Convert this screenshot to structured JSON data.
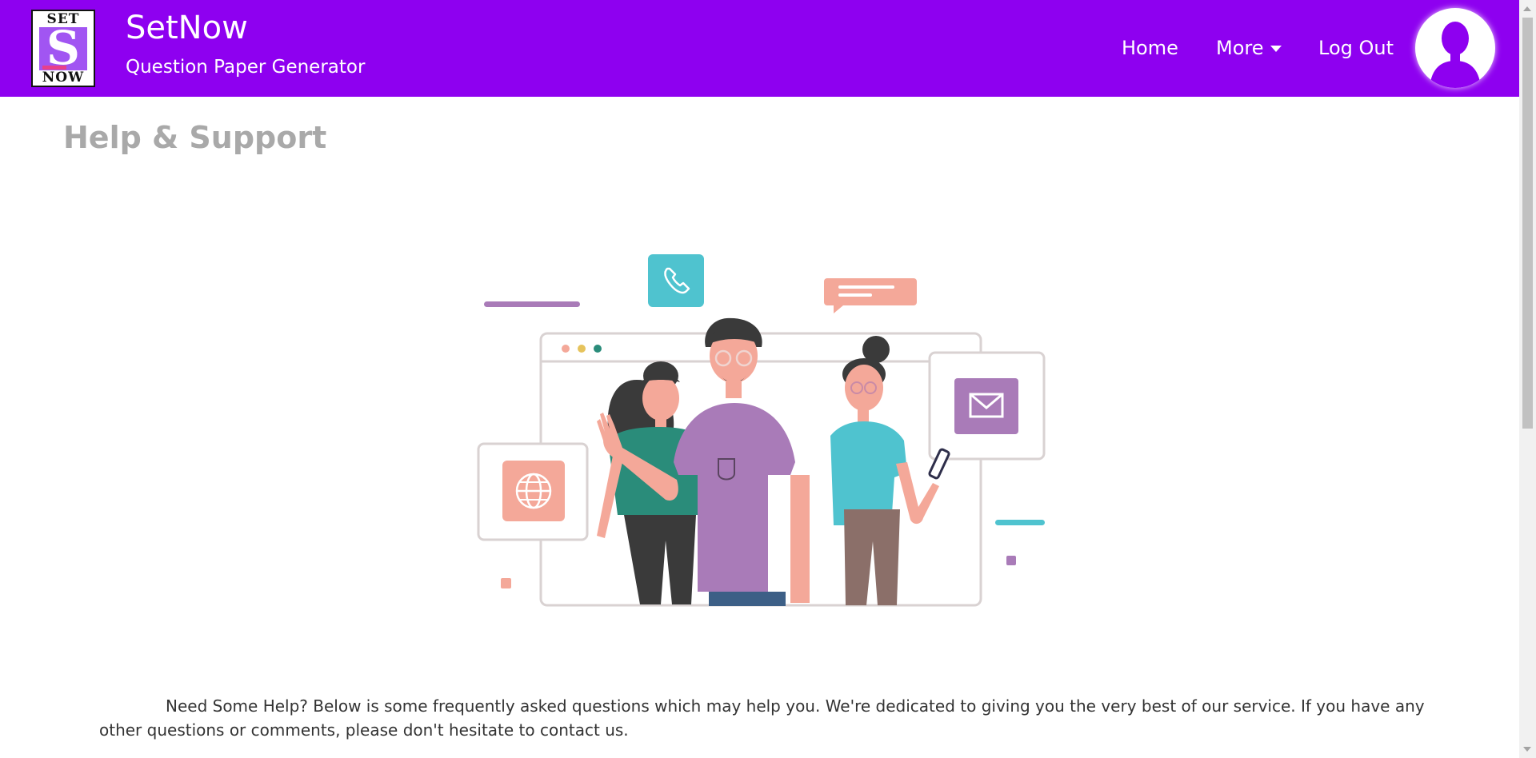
{
  "brand": {
    "logo_top": "SET",
    "logo_letter": "S",
    "logo_bottom": "NOW",
    "title": "SetNow",
    "subtitle": "Question Paper Generator"
  },
  "nav": {
    "home": "Home",
    "more": "More",
    "logout": "Log Out"
  },
  "page": {
    "title": "Help & Support",
    "intro": "Need Some Help? Below is some frequently asked questions which may help you. We're dedicated to giving you the very best of our service. If you have any other questions or comments, please don't hesitate to contact us."
  },
  "colors": {
    "navbar": "#8e00f0",
    "title_gray": "#a9a9a9",
    "illustration_purple": "#a97bb8",
    "illustration_teal": "#4fc3cf",
    "illustration_salmon": "#f4a899"
  },
  "icons": [
    "chevron-down-icon",
    "user-avatar-icon",
    "phone-icon",
    "chat-bubble-icon",
    "mail-icon",
    "globe-icon"
  ]
}
